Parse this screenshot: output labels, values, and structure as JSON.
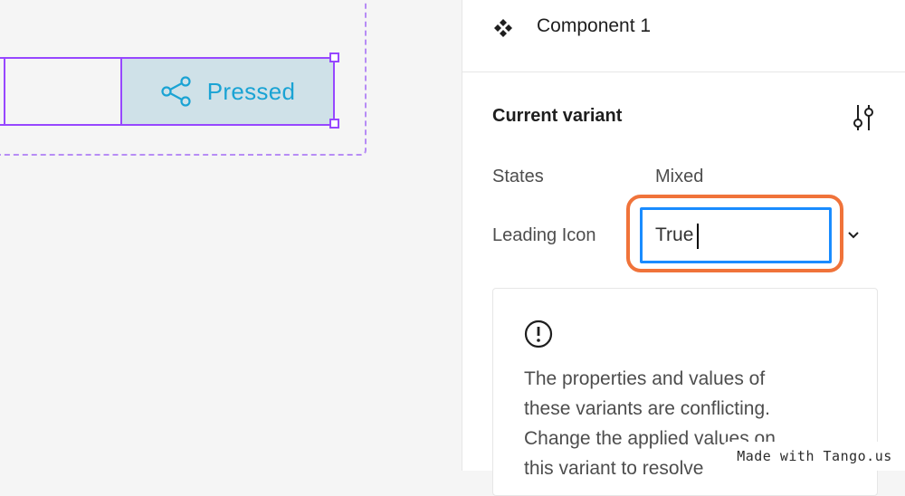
{
  "canvas": {
    "variant_label": "Pressed",
    "share_icon": "share-icon"
  },
  "panel": {
    "component_name": "Component 1",
    "component_icon": "component-icon",
    "section_title": "Current variant",
    "adjust_icon": "sliders-icon",
    "properties": [
      {
        "label": "States",
        "value": "Mixed"
      },
      {
        "label": "Leading Icon",
        "value": "True"
      }
    ],
    "dropdown_icon": "chevron-down-icon",
    "warning_icon": "alert-circle-icon",
    "warning_lines": [
      "The properties and values of",
      "these variants are conflicting.",
      "Change the applied values on",
      "this variant to resolve"
    ]
  },
  "watermark": "Made with Tango.us",
  "colors": {
    "selection": "#9747ff",
    "pressed_bg": "#cfe1e8",
    "pressed_text": "#1aa3d4",
    "focus": "#1a8cff",
    "highlight": "#f0733a"
  }
}
